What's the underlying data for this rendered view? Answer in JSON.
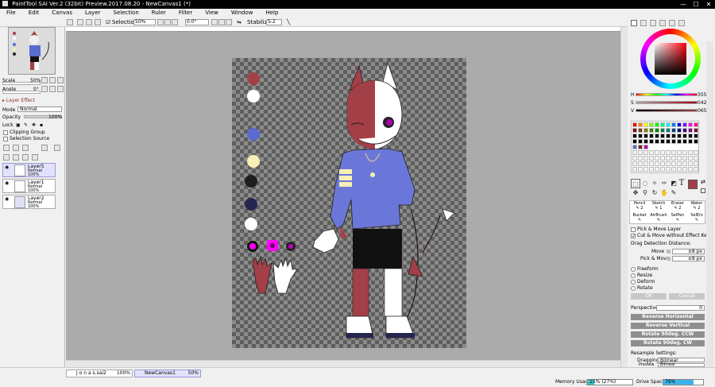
{
  "window": {
    "title": "PaintTool SAI Ver.2 (32bit) Preview.2017.08.20 - NewCanvas1 (*)",
    "minimize": "—",
    "maximize": "☐",
    "close": "✕"
  },
  "menu": [
    "File",
    "Edit",
    "Canvas",
    "Layer",
    "Selection",
    "Ruler",
    "Filter",
    "View",
    "Window",
    "Help"
  ],
  "toolbar": {
    "selection_label": "Selection",
    "zoom": "50%",
    "rotation": "0.0°",
    "stabilizer_label": "Stabilizer",
    "stabilizer_value": "S-2"
  },
  "navigator": {
    "scale_label": "Scale",
    "scale_value": "50%",
    "angle_label": "Angle",
    "angle_value": "0°"
  },
  "layer_panel": {
    "header": "Layer Effect",
    "mode_label": "Mode",
    "mode_value": "Normal",
    "opacity_label": "Opacity",
    "opacity_value": "100%",
    "lock_label": "Lock",
    "clipping_group": "Clipping Group",
    "selection_source": "Selection Source",
    "layers": [
      {
        "name": "Layer5",
        "mode": "Normal",
        "opacity": "100%"
      },
      {
        "name": "Layer1",
        "mode": "Normal",
        "opacity": "100%"
      },
      {
        "name": "Layer2",
        "mode": "Normal",
        "opacity": "100%"
      }
    ]
  },
  "color": {
    "h_label": "H",
    "h_value": "355",
    "s_label": "S",
    "s_value": "042",
    "v_label": "V",
    "v_value": "065",
    "current_color": "#a33f47",
    "palette": [
      "#ff0000",
      "#ff7f00",
      "#ffff00",
      "#7fff00",
      "#00ff00",
      "#00ff7f",
      "#00ffff",
      "#007fff",
      "#0000ff",
      "#7f00ff",
      "#ff00ff",
      "#ff007f",
      "#7f0000",
      "#7f3f00",
      "#7f7f00",
      "#3f7f00",
      "#007f00",
      "#007f3f",
      "#007f7f",
      "#003f7f",
      "#00007f",
      "#3f007f",
      "#7f007f",
      "#7f003f",
      "#000000",
      "#000000",
      "#000000",
      "#000000",
      "#000000",
      "#000000",
      "#000000",
      "#000000",
      "#000000",
      "#000000",
      "#000000",
      "#000000",
      "#000000",
      "#000000",
      "#000000",
      "#000000",
      "#000000",
      "#000000",
      "#000000",
      "#000000",
      "#000000",
      "#000000",
      "#000000",
      "#000000",
      "#5a6bd0",
      "#7b2020",
      "#aa00aa"
    ]
  },
  "tools": {
    "text_tool": "T",
    "brushes": [
      {
        "name": "Pencil",
        "size": "2"
      },
      {
        "name": "Sketch",
        "size": "1"
      },
      {
        "name": "Eraser",
        "size": "2"
      },
      {
        "name": "Water",
        "size": "2"
      },
      {
        "name": "Bucket",
        "size": ""
      },
      {
        "name": "AirBrush",
        "size": ""
      },
      {
        "name": "SelPen",
        "size": ""
      },
      {
        "name": "SelErs",
        "size": ""
      }
    ]
  },
  "tool_options": {
    "pick_move_layer": "Pick & Move Layer",
    "cut_move": "Cut & Move without Effect Key",
    "drag_detection": "Drag Detection Distance:",
    "move_label": "Move",
    "move_value": "±8 px",
    "pick_move_label": "Pick & Move",
    "pick_move_value": "±8 px",
    "modes": [
      "Freeform",
      "Resize",
      "Deform",
      "Rotate"
    ],
    "ok": "OK",
    "cancel": "Cancel",
    "perspective_label": "Perspective",
    "perspective_value": "0",
    "reverse_horizontal": "Reverse Horizontal",
    "reverse_vertical": "Reverse Vertical",
    "rotate_ccw": "Rotate 90deg. CCW",
    "rotate_cw": "Rotate 90deg. CW",
    "resample_settings": "Resample Settings:",
    "dragging_label": "Dragging",
    "dragging_value": "Bilinear",
    "preview_label": "Preview",
    "preview_value": "Bilinear",
    "final_label": "Final",
    "final_value": "Bicubic"
  },
  "status": {
    "tabs": [
      {
        "name": "J o n a s.sai2",
        "zoom": "100%"
      },
      {
        "name": "NewCanvas1",
        "zoom": "50%"
      }
    ],
    "memory_label": "Memory Usage",
    "memory_value": "15% (27%)",
    "memory_fraction": 0.15,
    "drive_label": "Drive Space",
    "drive_value": "76%",
    "drive_fraction": 0.76
  }
}
